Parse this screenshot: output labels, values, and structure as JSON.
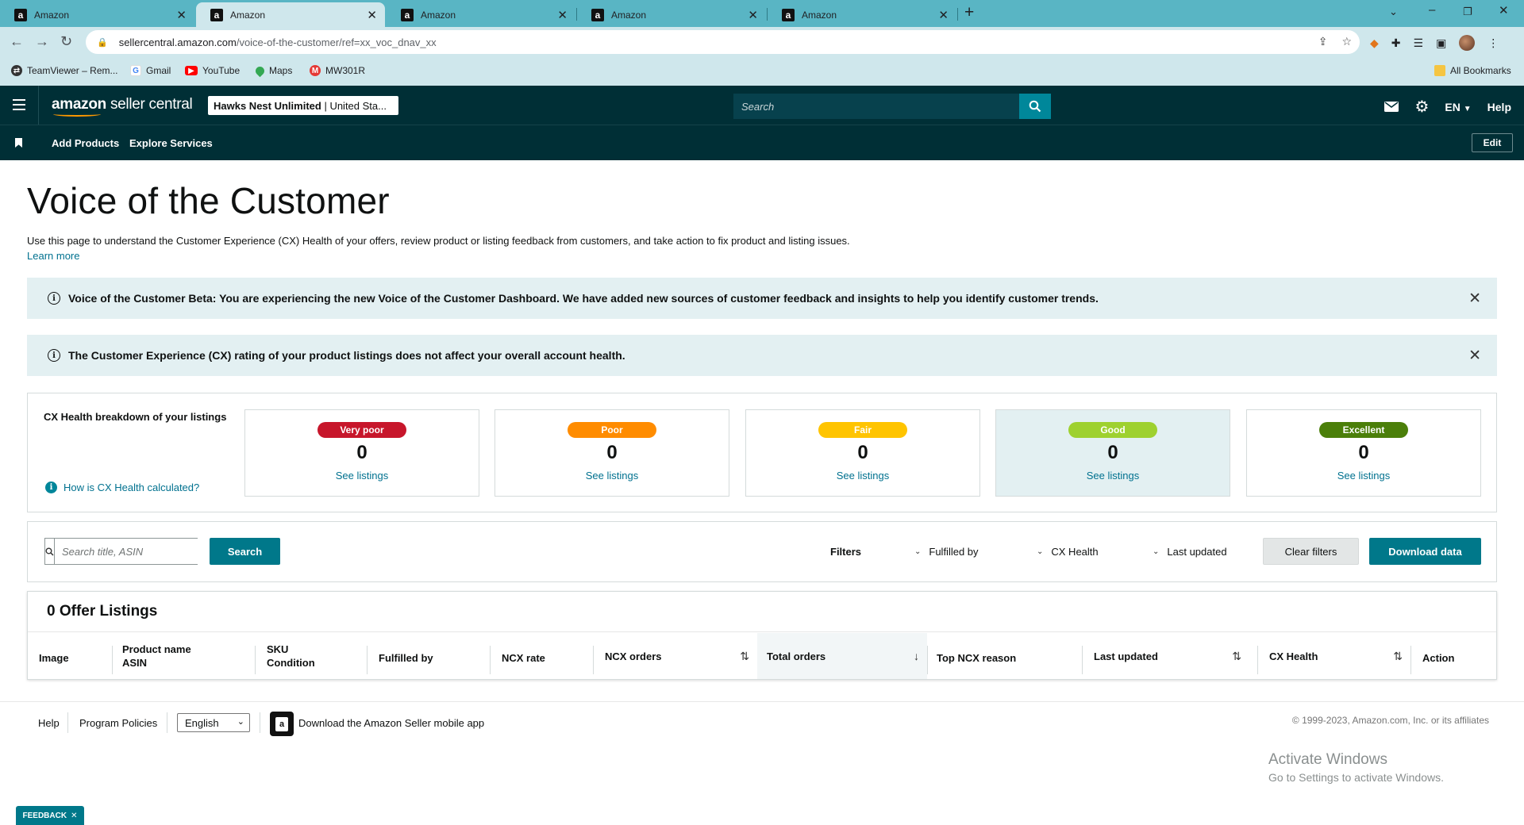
{
  "browser": {
    "tabs": [
      {
        "title": "Amazon",
        "favicon": "a",
        "active": false
      },
      {
        "title": "Amazon",
        "favicon": "a",
        "active": true
      },
      {
        "title": "Amazon",
        "favicon": "a",
        "active": false
      },
      {
        "title": "Amazon",
        "favicon": "a",
        "active": false
      },
      {
        "title": "Amazon",
        "favicon": "a",
        "active": false
      }
    ],
    "url_host": "sellercentral.amazon.com",
    "url_path": "/voice-of-the-customer/ref=xx_voc_dnav_xx",
    "bookmarks": [
      {
        "label": "TeamViewer – Rem...",
        "icon": "teamviewer-icon",
        "color": "#333333"
      },
      {
        "label": "Gmail",
        "icon": "google-icon",
        "color": "#4285f4"
      },
      {
        "label": "YouTube",
        "icon": "youtube-icon",
        "color": "#ff0000"
      },
      {
        "label": "Maps",
        "icon": "maps-icon",
        "color": "#34a853"
      },
      {
        "label": "MW301R",
        "icon": "mercusys-icon",
        "color": "#e53935"
      }
    ],
    "all_bookmarks": "All Bookmarks"
  },
  "header": {
    "logo_main": "amazon",
    "logo_sub": "seller central",
    "store_name": "Hawks Nest Unlimited",
    "store_market": "| United Sta...",
    "search_placeholder": "Search",
    "language": "EN",
    "help": "Help"
  },
  "subnav": {
    "links": [
      "Add Products",
      "Explore Services"
    ],
    "edit": "Edit"
  },
  "page": {
    "title": "Voice of the Customer",
    "description": "Use this page to understand the Customer Experience (CX) Health of your offers, review product or listing feedback from customers, and take action to fix product and listing issues.",
    "learn_more": "Learn more",
    "alerts": [
      "Voice of the Customer Beta: You are experiencing the new Voice of the Customer Dashboard. We have added new sources of customer feedback and insights to help you identify customer trends.",
      "The Customer Experience (CX) rating of your product listings does not affect your overall account health."
    ]
  },
  "cx_health": {
    "label": "CX Health breakdown of your listings",
    "how_link": "How is CX Health calculated?",
    "cards": [
      {
        "label": "Very poor",
        "count": "0",
        "link": "See listings",
        "color": "#c7162b"
      },
      {
        "label": "Poor",
        "count": "0",
        "link": "See listings",
        "color": "#ff8c00"
      },
      {
        "label": "Fair",
        "count": "0",
        "link": "See listings",
        "color": "#ffc400"
      },
      {
        "label": "Good",
        "count": "0",
        "link": "See listings",
        "color": "#9ed12f"
      },
      {
        "label": "Excellent",
        "count": "0",
        "link": "See listings",
        "color": "#4b7f0a"
      }
    ]
  },
  "filters": {
    "search_placeholder": "Search title, ASIN",
    "search_button": "Search",
    "filters_label": "Filters",
    "dropdowns": [
      "Fulfilled by",
      "CX Health",
      "Last updated"
    ],
    "clear": "Clear filters",
    "download": "Download data"
  },
  "table": {
    "title": "0 Offer Listings",
    "columns": {
      "image": "Image",
      "product_name": "Product name",
      "asin": "ASIN",
      "sku": "SKU",
      "condition": "Condition",
      "fulfilled_by": "Fulfilled by",
      "ncx_rate": "NCX rate",
      "ncx_orders": "NCX orders",
      "total_orders": "Total orders",
      "top_ncx_reason": "Top NCX reason",
      "last_updated": "Last updated",
      "cx_health": "CX Health",
      "action": "Action"
    }
  },
  "footer": {
    "help": "Help",
    "program_policies": "Program Policies",
    "language": "English",
    "app_download": "Download the Amazon Seller mobile app",
    "copyright": "© 1999-2023, Amazon.com, Inc. or its affiliates"
  },
  "overlay": {
    "activate_title": "Activate Windows",
    "activate_sub": "Go to Settings to activate Windows.",
    "feedback": "FEEDBACK"
  },
  "colors": {
    "header_bg": "#002f36",
    "accent": "#00788a",
    "alert_bg": "#e3f0f2",
    "chrome_tab_bar": "#59b5c4"
  }
}
